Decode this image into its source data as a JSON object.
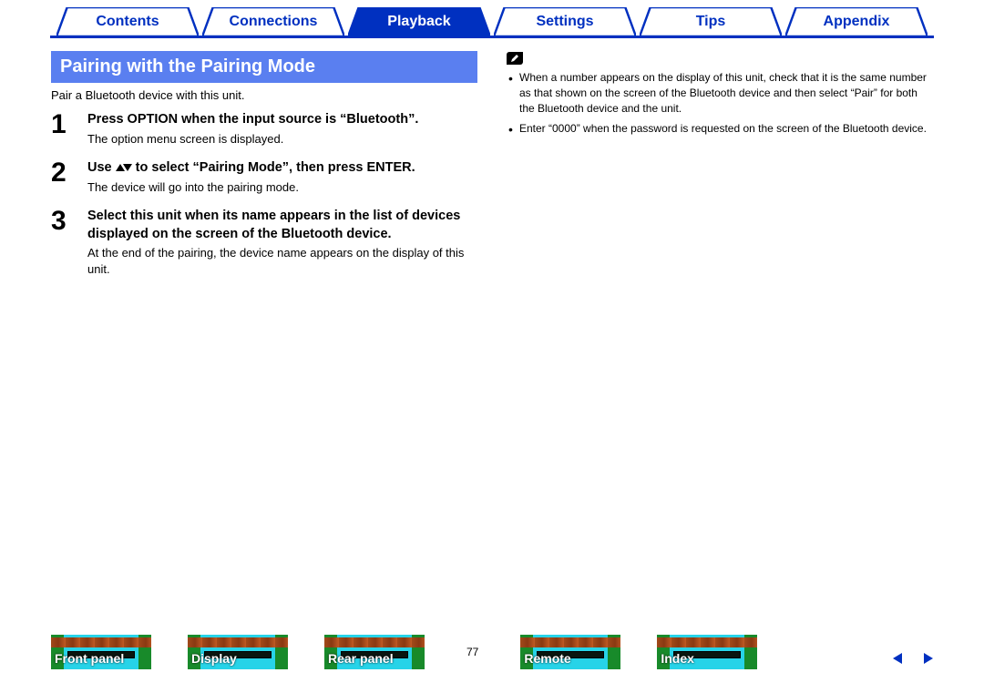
{
  "top_nav": {
    "items": [
      {
        "label": "Contents",
        "active": false
      },
      {
        "label": "Connections",
        "active": false
      },
      {
        "label": "Playback",
        "active": true
      },
      {
        "label": "Settings",
        "active": false
      },
      {
        "label": "Tips",
        "active": false
      },
      {
        "label": "Appendix",
        "active": false
      }
    ]
  },
  "section": {
    "title": "Pairing with the Pairing Mode",
    "intro": "Pair a Bluetooth device with this unit."
  },
  "steps": [
    {
      "num": "1",
      "title": "Press OPTION when the input source is “Bluetooth”.",
      "desc": "The option menu screen is displayed."
    },
    {
      "num": "2",
      "title_pre": "Use ",
      "title_post": " to select “Pairing Mode”, then press ENTER.",
      "desc": "The device will go into the pairing mode."
    },
    {
      "num": "3",
      "title": "Select this unit when its name appears in the list of devices displayed on the screen of the Bluetooth device.",
      "desc": "At the end of the pairing, the device name appears on the display of this unit."
    }
  ],
  "notes": [
    "When a number appears on the display of this unit, check that it is the same number as that shown on the screen of the Bluetooth device and then select “Pair” for both the Bluetooth device and the unit.",
    "Enter “0000” when the password is requested on the screen of the Bluetooth device."
  ],
  "bottom_nav": {
    "items": [
      {
        "label": "Front panel"
      },
      {
        "label": "Display"
      },
      {
        "label": "Rear panel"
      },
      {
        "label": "Remote"
      },
      {
        "label": "Index"
      }
    ],
    "page": "77"
  }
}
